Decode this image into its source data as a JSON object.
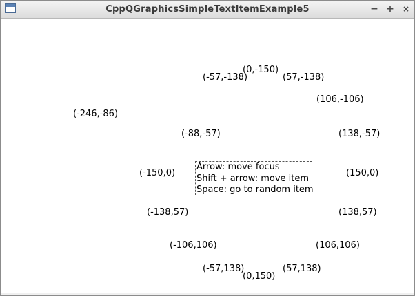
{
  "window": {
    "title": "CppQGraphicsSimpleTextItemExample5",
    "minimize": "−",
    "maximize": "+",
    "close": "×"
  },
  "scene": {
    "labels": [
      "(0,-150)",
      "(-57,-138)",
      "(57,-138)",
      "(106,-106)",
      "(-246,-86)",
      "(-88,-57)",
      "(138,-57)",
      "(-150,0)",
      "(150,0)",
      "(-138,57)",
      "(138,57)",
      "(-106,106)",
      "(106,106)",
      "(-57,138)",
      "(57,138)",
      "(0,150)"
    ],
    "focused_item": {
      "line1": "Arrow: move focus",
      "line2": "Shift + arrow: move item",
      "line3": "Space: go to random item"
    }
  }
}
